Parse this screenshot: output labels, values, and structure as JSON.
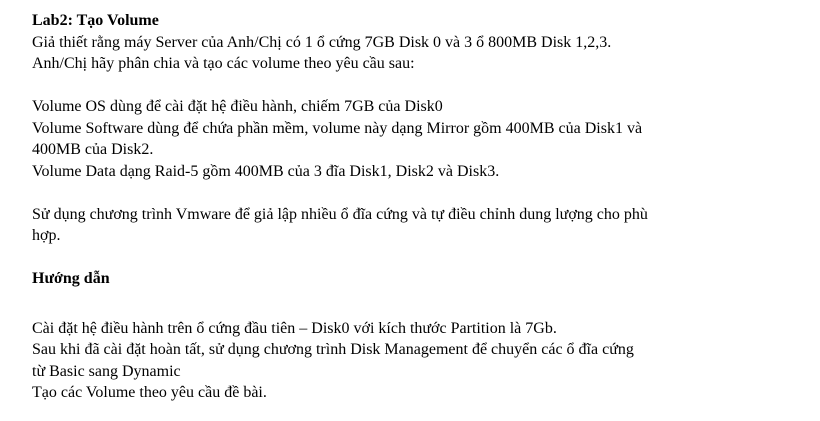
{
  "title": "Lab2: Tạo Volume",
  "intro": [
    "Giả thiết rằng máy Server của Anh/Chị có 1 ổ cứng 7GB Disk 0 và 3 ổ 800MB Disk 1,2,3.",
    "Anh/Chị hãy phân chia và tạo các volume theo yêu cầu sau:"
  ],
  "volumes": [
    "Volume OS dùng để cài đặt hệ điều hành, chiếm 7GB của Disk0",
    "Volume Software dùng để chứa phần mềm, volume này dạng Mirror gồm 400MB của Disk1 và",
    "400MB của Disk2.",
    "Volume Data dạng Raid-5 gồm 400MB của 3 đĩa Disk1, Disk2 và Disk3."
  ],
  "vmware_note": [
    "Sử dụng chương trình Vmware để giả lập nhiều ổ đĩa cứng và tự điều chỉnh dung lượng cho phù",
    "hợp."
  ],
  "guide_heading": "Hướng dẫn",
  "guide": [
    "Cài đặt hệ điều hành trên ổ cứng đầu tiên – Disk0 với kích thước Partition là 7Gb.",
    "Sau khi đã cài đặt hoàn tất, sử dụng chương trình Disk Management để chuyển các ổ đĩa cứng",
    "từ Basic sang Dynamic",
    "Tạo các Volume theo yêu cầu đề bài."
  ]
}
